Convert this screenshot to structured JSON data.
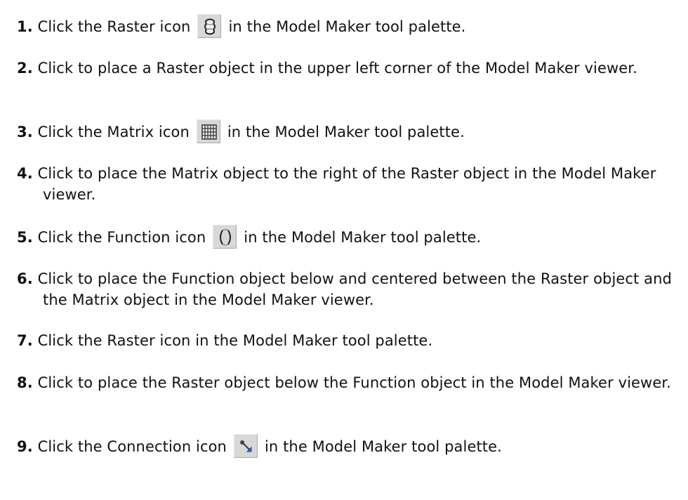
{
  "steps": [
    {
      "num": "1.",
      "before": "Click the Raster icon",
      "after": "in the Model Maker tool palette.",
      "icon": "raster-icon"
    },
    {
      "num": "2.",
      "text": "Click to place a Raster object in the upper left corner of the Model Maker viewer."
    },
    {
      "num": "3.",
      "before": "Click the Matrix icon",
      "after": "in the Model Maker tool palette.",
      "icon": "matrix-icon"
    },
    {
      "num": "4.",
      "text": "Click to place the Matrix object to the right of the Raster object in the Model Maker viewer."
    },
    {
      "num": "5.",
      "before": "Click the Function icon",
      "after": "in the Model Maker tool palette.",
      "icon": "function-icon"
    },
    {
      "num": "6.",
      "text": "Click to place the Function object below and centered between the Raster object and the Matrix object in the Model Maker viewer."
    },
    {
      "num": "7.",
      "text": "Click the Raster icon in the Model Maker tool palette."
    },
    {
      "num": "8.",
      "text": "Click to place the Raster object below the Function object in the Model Maker viewer."
    },
    {
      "num": "9.",
      "before": "Click the Connection icon",
      "after": "in the Model Maker tool palette.",
      "icon": "connection-icon"
    }
  ]
}
